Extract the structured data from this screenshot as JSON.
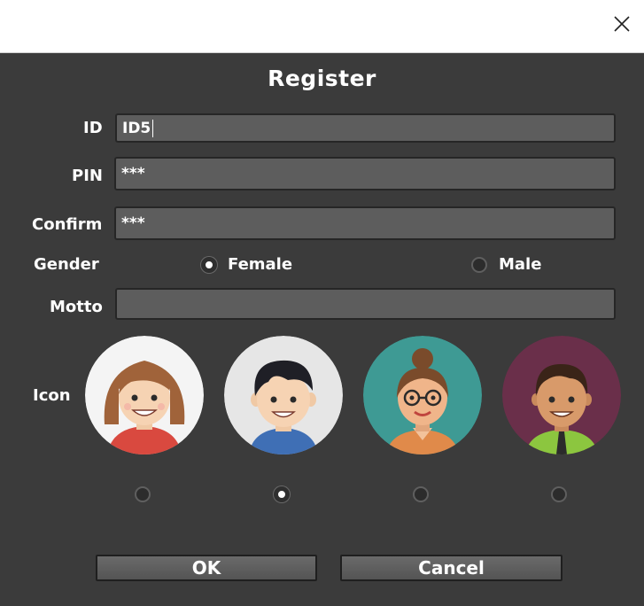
{
  "window": {
    "title": "Register",
    "close_icon": "close-icon"
  },
  "form": {
    "id_label": "ID",
    "id_value": "ID5",
    "pin_label": "PIN",
    "pin_value": "***",
    "confirm_label": "Confirm",
    "confirm_value": "***",
    "gender_label": "Gender",
    "gender_options": [
      "Female",
      "Male"
    ],
    "gender_selected": "Female",
    "motto_label": "Motto",
    "motto_value": "",
    "icon_label": "Icon",
    "icons": [
      "girl-avatar-icon",
      "boy-avatar-icon",
      "woman-glasses-avatar-icon",
      "man-tie-avatar-icon"
    ],
    "icon_selected_index": 1
  },
  "buttons": {
    "ok": "OK",
    "cancel": "Cancel"
  },
  "colors": {
    "background": "#3b3b3b",
    "field": "#5d5d5d",
    "text": "#ffffff"
  }
}
